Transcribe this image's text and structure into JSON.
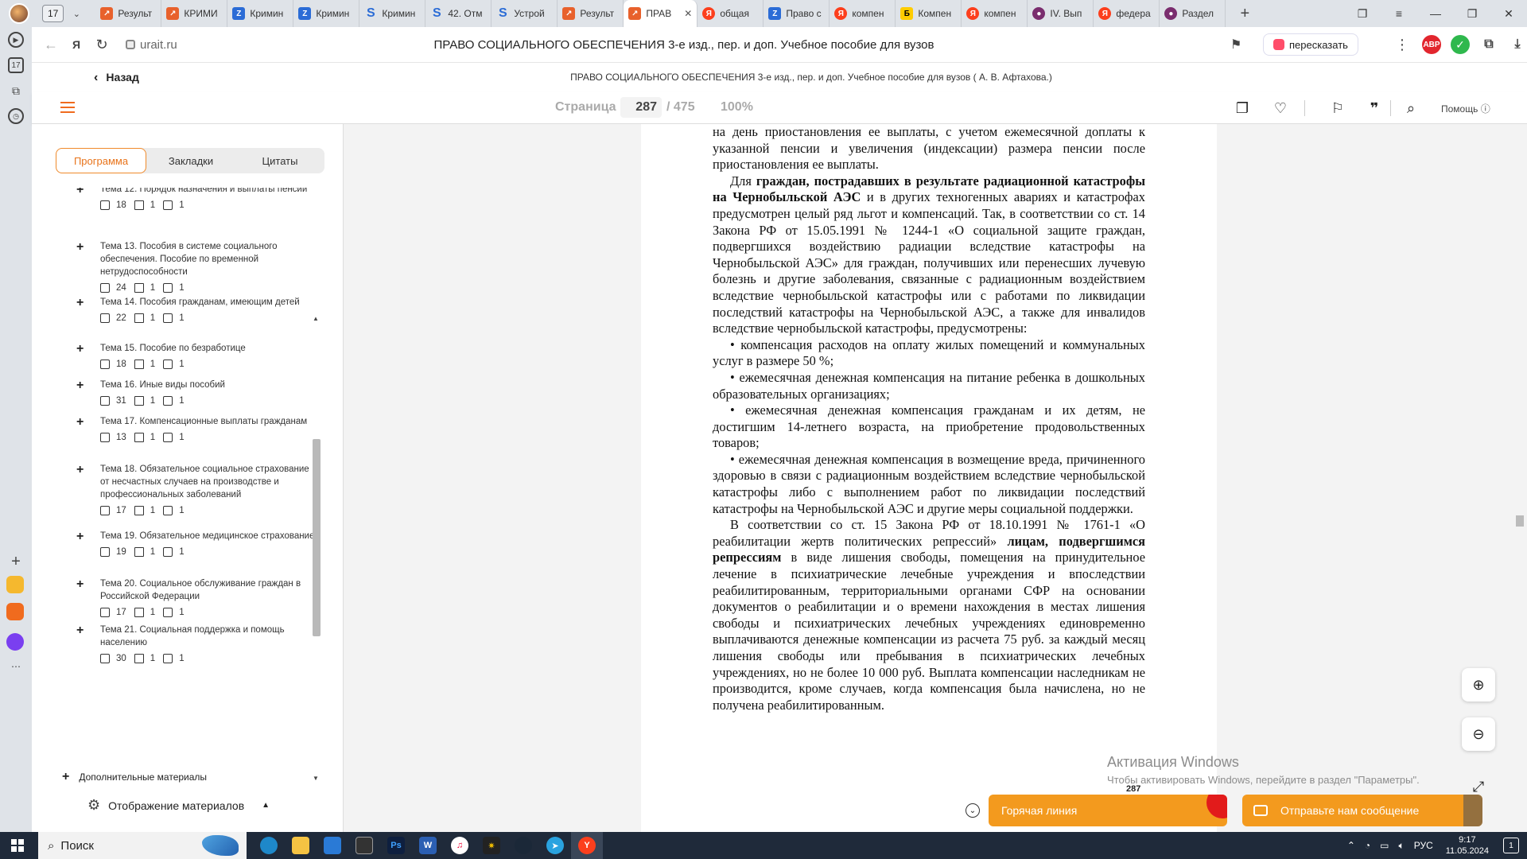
{
  "browser": {
    "tab_counter": "17",
    "tabs": [
      {
        "title": "Результ",
        "icon": "u"
      },
      {
        "title": "КРИМИ",
        "icon": "u"
      },
      {
        "title": "Кримин",
        "icon": "z"
      },
      {
        "title": "Кримин",
        "icon": "z"
      },
      {
        "title": "Кримин",
        "icon": "s"
      },
      {
        "title": "42. Отм",
        "icon": "s"
      },
      {
        "title": "Устрой",
        "icon": "s"
      },
      {
        "title": "Результ",
        "icon": "u"
      },
      {
        "title": "ПРАВ",
        "icon": "u",
        "active": true
      },
      {
        "title": "общая",
        "icon": "y"
      },
      {
        "title": "Право с",
        "icon": "z"
      },
      {
        "title": "компен",
        "icon": "y"
      },
      {
        "title": "Компен",
        "icon": "b"
      },
      {
        "title": "компен",
        "icon": "y"
      },
      {
        "title": "IV. Вып",
        "icon": "g"
      },
      {
        "title": "федера",
        "icon": "y"
      },
      {
        "title": "Раздел",
        "icon": "g"
      }
    ],
    "url": "urait.ru",
    "page_title": "ПРАВО СОЦИАЛЬНОГО ОБЕСПЕЧЕНИЯ 3-е изд., пер. и доп. Учебное пособие для вузов",
    "retell_label": "пересказать",
    "ext_abp": "ABP",
    "rail_calendar": "17"
  },
  "site": {
    "back_label": "Назад",
    "book_title": "ПРАВО СОЦИАЛЬНОГО ОБЕСПЕЧЕНИЯ 3-е изд., пер. и доп. Учебное пособие для вузов ( А. В. Афтахова.)"
  },
  "reader": {
    "page_label": "Страница",
    "page_current": "287",
    "page_total": "/ 475",
    "zoom": "100%",
    "help_label": "Помощь"
  },
  "sidebar": {
    "tabs": [
      "Программа",
      "Закладки",
      "Цитаты"
    ],
    "items": [
      {
        "title": "Тема 12. Порядок назначения и выплаты пенсий",
        "a": "18",
        "b": "1",
        "c": "1"
      },
      {
        "title": "Тема 13. Пособия в системе социального обеспечения. Пособие по временной нетрудоспособности",
        "a": "24",
        "b": "1",
        "c": "1"
      },
      {
        "title": "Тема 14. Пособия гражданам, имеющим детей",
        "a": "22",
        "b": "1",
        "c": "1"
      },
      {
        "title": "Тема 15. Пособие по безработице",
        "a": "18",
        "b": "1",
        "c": "1"
      },
      {
        "title": "Тема 16. Иные виды пособий",
        "a": "31",
        "b": "1",
        "c": "1"
      },
      {
        "title": "Тема 17. Компенсационные выплаты гражданам",
        "a": "13",
        "b": "1",
        "c": "1"
      },
      {
        "title": "Тема 18. Обязательное социальное страхование от несчастных случаев на производстве и профессиональных заболеваний",
        "a": "17",
        "b": "1",
        "c": "1"
      },
      {
        "title": "Тема 19. Обязательное медицинское страхование",
        "a": "19",
        "b": "1",
        "c": "1"
      },
      {
        "title": "Тема 20. Социальное обслуживание граждан в Российской Федерации",
        "a": "17",
        "b": "1",
        "c": "1"
      },
      {
        "title": "Тема 21. Социальная поддержка и помощь населению",
        "a": "30",
        "b": "1",
        "c": "1"
      }
    ],
    "extra_materials": "Дополнительные материалы",
    "display_materials": "Отображение материалов"
  },
  "document": {
    "paragraphs": [
      {
        "indent": false,
        "html": "на день приостановления ее выплаты, с учетом ежемесячной допла­ты к указанной пенсии и увеличения (индексации) размера пенсии после приостановления ее выплаты."
      },
      {
        "indent": true,
        "html": "Для <b>граждан, пострадавших в результате радиационной ката­строфы на Чернобыльской АЭС</b> и в других техногенных авариях и катастрофах предусмотрен целый ряд льгот и компенсаций. Так, в соответствии со ст. 14 Закона РФ от 15.05.1991 № 1244-1 «О со­циальной защите граждан, подвергшихся воздействию радиации вследствие катастрофы на Чернобыльской АЭС» для граждан, по­лучивших или перенесших лучевую болезнь и другие заболевания, связанные с радиационным воздействием вследствие чернобыль­ской катастрофы или с работами по ликвидации последствий ката­строфы на Чернобыльской АЭС, а также для инвалидов вследствие чернобыльской катастрофы, предусмотрены:"
      },
      {
        "indent": true,
        "html": "• компенсация расходов на оплату жилых помещений и комму­нальных услуг в размере 50 %;"
      },
      {
        "indent": true,
        "html": "• ежемесячная денежная компенсация на питание ребенка в до­школьных образовательных организациях;"
      },
      {
        "indent": true,
        "html": "• ежемесячная денежная компенсация гражданам и их детям, не достигшим 14-летнего возраста, на приобретение продоволь­ственных товаров;"
      },
      {
        "indent": true,
        "html": "• ежемесячная денежная компенсация в возмещение вреда, причиненного здоровью в связи с радиационным воздействием вследствие чернобыльской катастрофы либо с выполнением работ по ликвидации последствий катастрофы на Чернобыльской АЭС и другие меры социальной поддержки."
      },
      {
        "indent": true,
        "html": "В соответствии со ст. 15 Закона РФ от 18.10.1991 № 1761-1 «О реабилитации жертв политических репрессий» <b>лицам, подверг­шимся репрессиям</b> в виде лишения свободы, помещения на при­нудительное лечение в психиатрические лечебные учреждения и впоследствии реабилитированным, территориальными органа­ми СФР на основании документов о реабилитации и о времени на­хождения в местах лишения свободы и психиатрических лечебных учреждениях единовременно выплачиваются денежные компен­сации из расчета 75 руб. за каждый месяц лишения свободы или пребывания в психиатрических лечебных учреждениях, но не более 10 000 руб. Выплата компенсации наследникам не производится, кроме случаев, когда компенсация была начислена, но не получена реабилитированным."
      }
    ],
    "page_number": "287"
  },
  "overlay": {
    "watermark_title": "Активация Windows",
    "watermark_sub": "Чтобы активировать Windows, перейдите в раздел \"Параметры\".",
    "hotline_label": "Горячая линия",
    "message_label": "Отправьте нам сообщение"
  },
  "taskbar": {
    "search_label": "Поиск",
    "lang": "РУС",
    "time": "9:17",
    "date": "11.05.2024",
    "notif_count": "1"
  }
}
